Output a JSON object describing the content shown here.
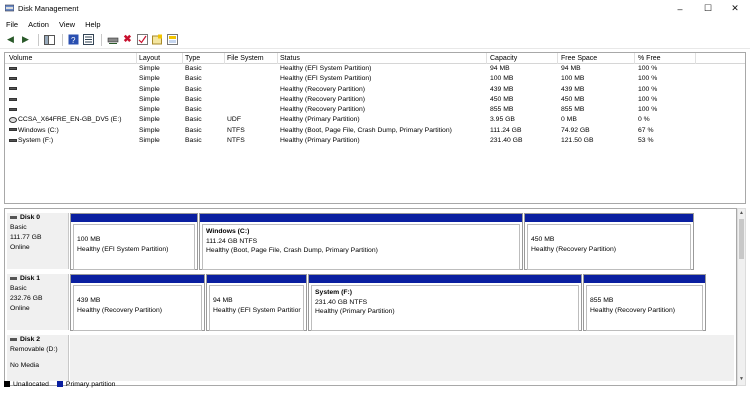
{
  "window": {
    "title": "Disk Management"
  },
  "menu": [
    "File",
    "Action",
    "View",
    "Help"
  ],
  "volume_table": {
    "columns": [
      "Volume",
      "Layout",
      "Type",
      "File System",
      "Status",
      "Capacity",
      "Free Space",
      "% Free"
    ],
    "rows": [
      {
        "volume": "",
        "layout": "Simple",
        "type": "Basic",
        "fs": "",
        "status": "Healthy (EFI System Partition)",
        "capacity": "94 MB",
        "free": "94 MB",
        "pct": "100 %"
      },
      {
        "volume": "",
        "layout": "Simple",
        "type": "Basic",
        "fs": "",
        "status": "Healthy (EFI System Partition)",
        "capacity": "100 MB",
        "free": "100 MB",
        "pct": "100 %"
      },
      {
        "volume": "",
        "layout": "Simple",
        "type": "Basic",
        "fs": "",
        "status": "Healthy (Recovery Partition)",
        "capacity": "439 MB",
        "free": "439 MB",
        "pct": "100 %"
      },
      {
        "volume": "",
        "layout": "Simple",
        "type": "Basic",
        "fs": "",
        "status": "Healthy (Recovery Partition)",
        "capacity": "450 MB",
        "free": "450 MB",
        "pct": "100 %"
      },
      {
        "volume": "",
        "layout": "Simple",
        "type": "Basic",
        "fs": "",
        "status": "Healthy (Recovery Partition)",
        "capacity": "855 MB",
        "free": "855 MB",
        "pct": "100 %"
      },
      {
        "volume": "CCSA_X64FRE_EN-GB_DV5 (E:)",
        "layout": "Simple",
        "type": "Basic",
        "fs": "UDF",
        "status": "Healthy (Primary Partition)",
        "capacity": "3.95 GB",
        "free": "0 MB",
        "pct": "0 %"
      },
      {
        "volume": "Windows (C:)",
        "layout": "Simple",
        "type": "Basic",
        "fs": "NTFS",
        "status": "Healthy (Boot, Page File, Crash Dump, Primary Partition)",
        "capacity": "111.24 GB",
        "free": "74.92 GB",
        "pct": "67 %"
      },
      {
        "volume": "System (F:)",
        "layout": "Simple",
        "type": "Basic",
        "fs": "NTFS",
        "status": "Healthy (Primary Partition)",
        "capacity": "231.40 GB",
        "free": "121.50 GB",
        "pct": "53 %"
      }
    ]
  },
  "disks": [
    {
      "name": "Disk 0",
      "kind": "Basic",
      "size": "111.77 GB",
      "state": "Online",
      "partitions": [
        {
          "name": "",
          "size": "100 MB",
          "status": "Healthy (EFI System Partition)"
        },
        {
          "name": "Windows  (C:)",
          "size": "111.24 GB NTFS",
          "status": "Healthy (Boot, Page File, Crash Dump, Primary Partition)"
        },
        {
          "name": "",
          "size": "450 MB",
          "status": "Healthy (Recovery Partition)"
        }
      ]
    },
    {
      "name": "Disk 1",
      "kind": "Basic",
      "size": "232.76 GB",
      "state": "Online",
      "partitions": [
        {
          "name": "",
          "size": "439 MB",
          "status": "Healthy (Recovery Partition)"
        },
        {
          "name": "",
          "size": "94 MB",
          "status": "Healthy (EFI System Partitior"
        },
        {
          "name": "System  (F:)",
          "size": "231.40 GB NTFS",
          "status": "Healthy (Primary Partition)"
        },
        {
          "name": "",
          "size": "855 MB",
          "status": "Healthy (Recovery Partition)"
        }
      ]
    },
    {
      "name": "Disk 2",
      "kind": "Removable (D:)",
      "size": "",
      "state": "No Media",
      "partitions": []
    }
  ],
  "legend": [
    {
      "label": "Unallocated",
      "color": "#000000"
    },
    {
      "label": "Primary partition",
      "color": "#0a1fa0"
    }
  ],
  "colors": {
    "primary_bar": "#0a1fa0",
    "unallocated": "#000000"
  }
}
